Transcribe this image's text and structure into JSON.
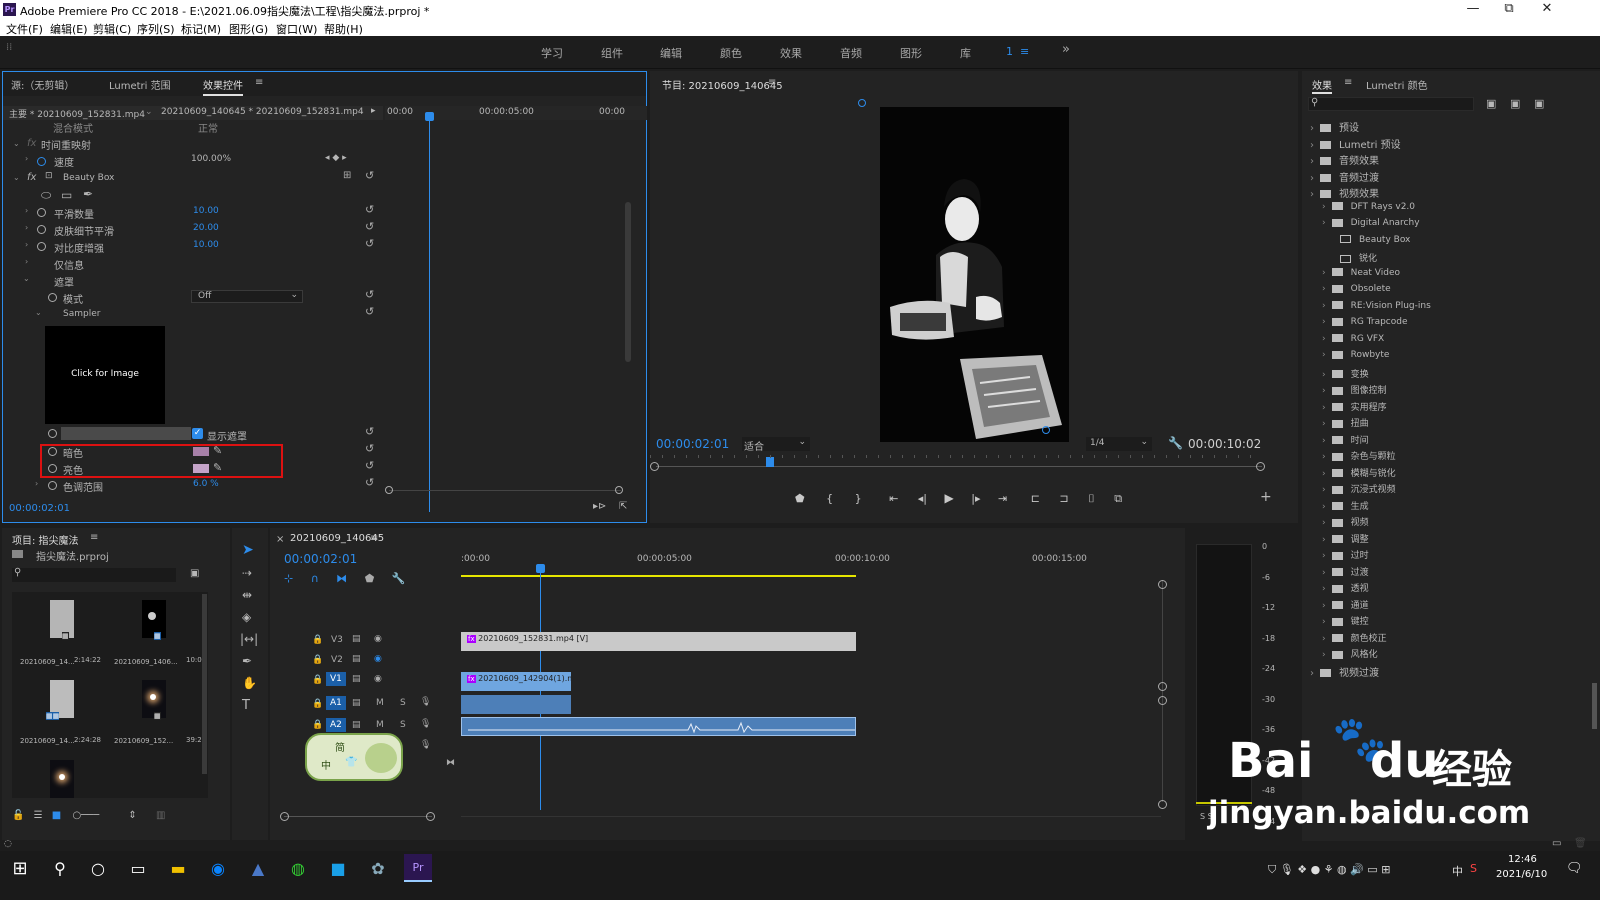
{
  "window": {
    "title": "Adobe Premiere Pro CC 2018 - E:\\2021.06.09指尖魔法\\工程\\指尖魔法.prproj *",
    "app_icon": "Pr",
    "minimize": "—",
    "maximize": "⧉",
    "close": "✕"
  },
  "menu": [
    "文件(F)",
    "编辑(E)",
    "剪辑(C)",
    "序列(S)",
    "标记(M)",
    "图形(G)",
    "窗口(W)",
    "帮助(H)"
  ],
  "workspaces": [
    "学习",
    "组件",
    "编辑",
    "颜色",
    "效果",
    "音频",
    "图形",
    "库",
    "1",
    "≡",
    "»"
  ],
  "effect_controls": {
    "tabs": [
      "源:（无剪辑）",
      "Lumetri 范围",
      "效果控件"
    ],
    "tab_menu": "≡",
    "master": "主要 * 20210609_152831.mp4",
    "sequence": "20210609_140645 * 20210609_152831.mp4",
    "ruler": [
      "00:00",
      "00:00:05:00",
      "00:00"
    ],
    "rows": {
      "blend": "混合模式",
      "blend_val": "正常",
      "time_remap": "时间重映射",
      "speed": "速度",
      "speed_val": "100.00%",
      "beauty_box": "Beauty Box",
      "smooth": "平滑数量",
      "smooth_val": "10.00",
      "skin": "皮肤细节平滑",
      "skin_val": "20.00",
      "contrast": "对比度增强",
      "contrast_val": "10.00",
      "info": "仅信息",
      "mask": "遮罩",
      "mode": "模式",
      "mode_val": "Off",
      "sampler": "Sampler",
      "click_image": "Click for Image",
      "show_mask": "显示遮罩",
      "dark": "暗色",
      "light": "亮色",
      "range": "色调范围",
      "range_val": "6.0 %",
      "fx": "fx"
    },
    "timecode": "00:00:02:01"
  },
  "program": {
    "title": "节目: 20210609_140645",
    "menu": "≡",
    "timecode": "00:00:02:01",
    "fit": "适合",
    "quality": "1/4",
    "duration": "00:00:10:02"
  },
  "effects": {
    "tabs": [
      "效果",
      "Lumetri 颜色"
    ],
    "tab_menu": "≡",
    "tree": [
      {
        "label": "预设",
        "level": 0
      },
      {
        "label": "Lumetri 预设",
        "level": 0
      },
      {
        "label": "音频效果",
        "level": 0
      },
      {
        "label": "音频过渡",
        "level": 0
      },
      {
        "label": "视频效果",
        "level": 0
      },
      {
        "label": "DFT Rays v2.0",
        "level": 1
      },
      {
        "label": "Digital Anarchy",
        "level": 1
      },
      {
        "label": "Beauty Box",
        "level": 2
      },
      {
        "label": "锐化",
        "level": 2
      },
      {
        "label": "Neat Video",
        "level": 1
      },
      {
        "label": "Obsolete",
        "level": 1
      },
      {
        "label": "RE:Vision Plug-ins",
        "level": 1
      },
      {
        "label": "RG Trapcode",
        "level": 1
      },
      {
        "label": "RG VFX",
        "level": 1
      },
      {
        "label": "Rowbyte",
        "level": 1
      },
      {
        "label": "变换",
        "level": 1
      },
      {
        "label": "图像控制",
        "level": 1
      },
      {
        "label": "实用程序",
        "level": 1
      },
      {
        "label": "扭曲",
        "level": 1
      },
      {
        "label": "时间",
        "level": 1
      },
      {
        "label": "杂色与颗粒",
        "level": 1
      },
      {
        "label": "模糊与锐化",
        "level": 1
      },
      {
        "label": "沉浸式视频",
        "level": 1
      },
      {
        "label": "生成",
        "level": 1
      },
      {
        "label": "视频",
        "level": 1
      },
      {
        "label": "调整",
        "level": 1
      },
      {
        "label": "过时",
        "level": 1
      },
      {
        "label": "过渡",
        "level": 1
      },
      {
        "label": "透视",
        "level": 1
      },
      {
        "label": "通道",
        "level": 1
      },
      {
        "label": "键控",
        "level": 1
      },
      {
        "label": "颜色校正",
        "level": 1
      },
      {
        "label": "风格化",
        "level": 1
      },
      {
        "label": "视频过渡",
        "level": 0
      }
    ]
  },
  "project": {
    "title": "项目: 指尖魔法",
    "menu": "≡",
    "file": "指尖魔法.prproj",
    "items": [
      {
        "name": "20210609_14...",
        "dur": "2:14:22"
      },
      {
        "name": "20210609_1406...",
        "dur": "10:02"
      },
      {
        "name": "20210609_14...",
        "dur": "2:24:28"
      },
      {
        "name": "20210609_152...",
        "dur": "39:24"
      }
    ]
  },
  "timeline": {
    "tab": "20210609_140645",
    "menu": "≡",
    "close": "×",
    "timecode": "00:00:02:01",
    "ruler": [
      ":00:00",
      "00:00:05:00",
      "00:00:10:00",
      "00:00:15:00"
    ],
    "tracks": [
      "V3",
      "V2",
      "V1",
      "A1",
      "A2"
    ],
    "clip_v3": "20210609_152831.mp4 [V]",
    "clip_v1": "20210609_142904(1).mp4 [V]",
    "ms": [
      "M",
      "S"
    ]
  },
  "meter": {
    "ticks": [
      "0",
      "-6",
      "-12",
      "-18",
      "-24",
      "-30",
      "-36",
      "-42",
      "-48",
      "-54"
    ],
    "solo": "S  S"
  },
  "ime": {
    "jian": "简",
    "zhong": "中"
  },
  "watermark": {
    "brand": "Bai",
    "brand2": "du",
    "cn": "经验",
    "url": "jingyan.baidu.com"
  },
  "taskbar": {
    "time": "12:46",
    "date": "2021/6/10",
    "ime": "中",
    "app": "Pr"
  }
}
